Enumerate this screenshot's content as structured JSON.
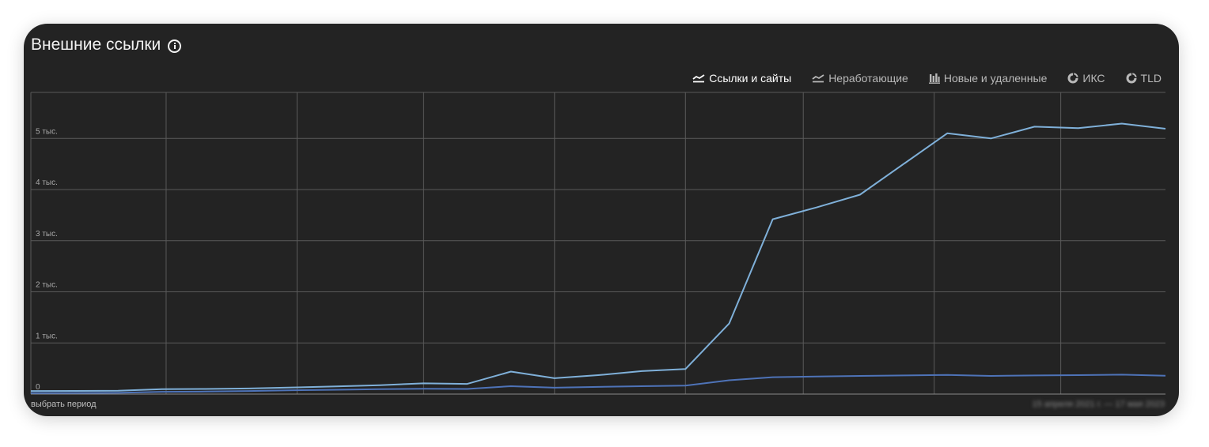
{
  "header": {
    "title": "Внешние ссылки",
    "info_icon": "info-circle-icon"
  },
  "tabs": [
    {
      "label": "Ссылки и сайты",
      "icon": "line-chart-icon",
      "active": true
    },
    {
      "label": "Неработающие",
      "icon": "line-chart-icon",
      "active": false
    },
    {
      "label": "Новые и удаленные",
      "icon": "bar-chart-icon",
      "active": false
    },
    {
      "label": "ИКС",
      "icon": "pie-chart-icon",
      "active": false
    },
    {
      "label": "TLD",
      "icon": "pie-chart-icon",
      "active": false
    }
  ],
  "footer": {
    "period_label": "выбрать период",
    "date_range": "15 апреля 2021 г. — 17 мая 2023"
  },
  "colors": {
    "background": "#232323",
    "grid": "#5a5a5a",
    "series_links": "#7fb0d9",
    "series_sites": "#4e73b8"
  },
  "chart_data": {
    "type": "line",
    "title": "",
    "xlabel": "",
    "ylabel": "",
    "ylim": [
      0,
      5900
    ],
    "y_ticks": [
      {
        "value": 0,
        "label": "0"
      },
      {
        "value": 1000,
        "label": "1 тыс."
      },
      {
        "value": 2000,
        "label": "2 тыс."
      },
      {
        "value": 3000,
        "label": "3 тыс."
      },
      {
        "value": 4000,
        "label": "4 тыс."
      },
      {
        "value": 5000,
        "label": "5 тыс."
      }
    ],
    "x": [
      0,
      1,
      2,
      3,
      4,
      5,
      6,
      7,
      8,
      9,
      10,
      11,
      12,
      13,
      14,
      15,
      16,
      17,
      18,
      19,
      20,
      21,
      22,
      23,
      24,
      25,
      26
    ],
    "xlim": [
      0,
      26
    ],
    "x_grid": [
      0,
      3.1,
      6.1,
      9.0,
      12.0,
      15.0,
      17.7,
      20.7,
      23.6
    ],
    "grid": true,
    "legend": "none",
    "series": [
      {
        "values": [
          60,
          62,
          65,
          95,
          100,
          110,
          130,
          150,
          175,
          210,
          200,
          440,
          310,
          370,
          450,
          490,
          1380,
          3420,
          3650,
          3900,
          4500,
          5100,
          5000,
          5230,
          5200,
          5290,
          5190
        ]
      },
      {
        "values": [
          20,
          22,
          25,
          45,
          50,
          60,
          75,
          85,
          95,
          105,
          100,
          155,
          125,
          140,
          155,
          165,
          270,
          330,
          345,
          355,
          365,
          375,
          355,
          365,
          370,
          380,
          360
        ]
      }
    ]
  }
}
